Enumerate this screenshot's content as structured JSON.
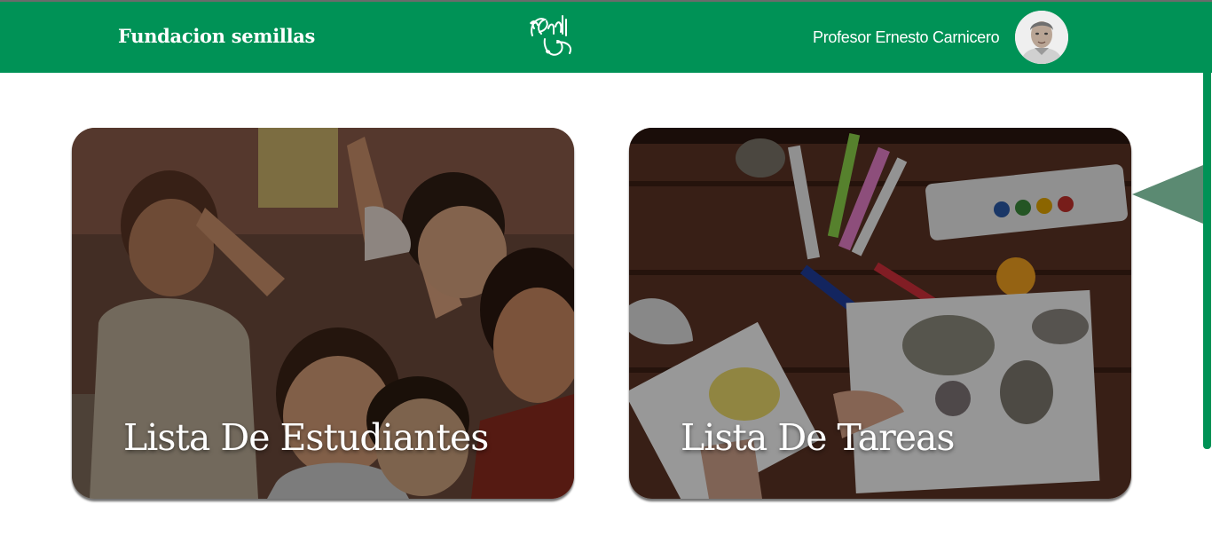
{
  "header": {
    "brand": "Fundacion semillas",
    "logo_icon": "semillas-leaf-logo-icon",
    "user_name": "Profesor Ernesto Carnicero",
    "avatar_icon": "user-avatar-icon",
    "background_color": "#009256"
  },
  "cards": [
    {
      "title": "Lista De Estudiantes",
      "image_icon": "children-photo-icon"
    },
    {
      "title": "Lista De Tareas",
      "image_icon": "art-supplies-photo-icon"
    }
  ],
  "colors": {
    "accent": "#009256",
    "tooltip": "#5b8a72",
    "text_light": "#ffffff"
  }
}
